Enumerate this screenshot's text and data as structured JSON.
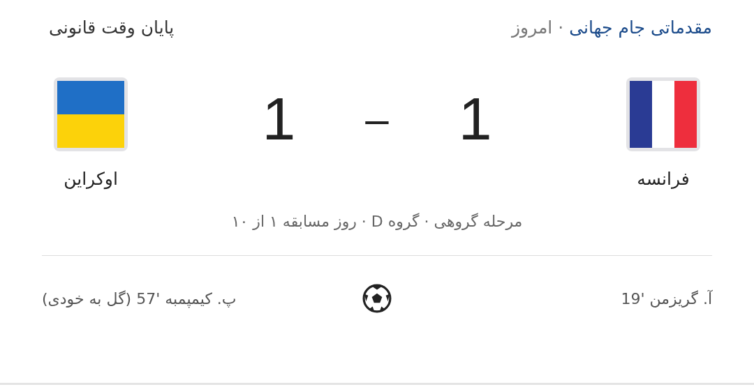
{
  "header": {
    "competition": "مقدماتی جام جهانی",
    "date": "· امروز",
    "status": "پایان وقت قانونی"
  },
  "teams": [
    {
      "name": "فرانسه",
      "score": "1"
    },
    {
      "name": "اوکراین",
      "score": "1"
    }
  ],
  "score_separator": "–",
  "match_info": "مرحله گروهی · گروه D · روز مسابقه ۱ از ۱۰",
  "scorers": [
    {
      "text": "آ. گریزمن '19"
    },
    {
      "text": "پ. کیمپمبه '57 (گل به خودی)"
    }
  ]
}
